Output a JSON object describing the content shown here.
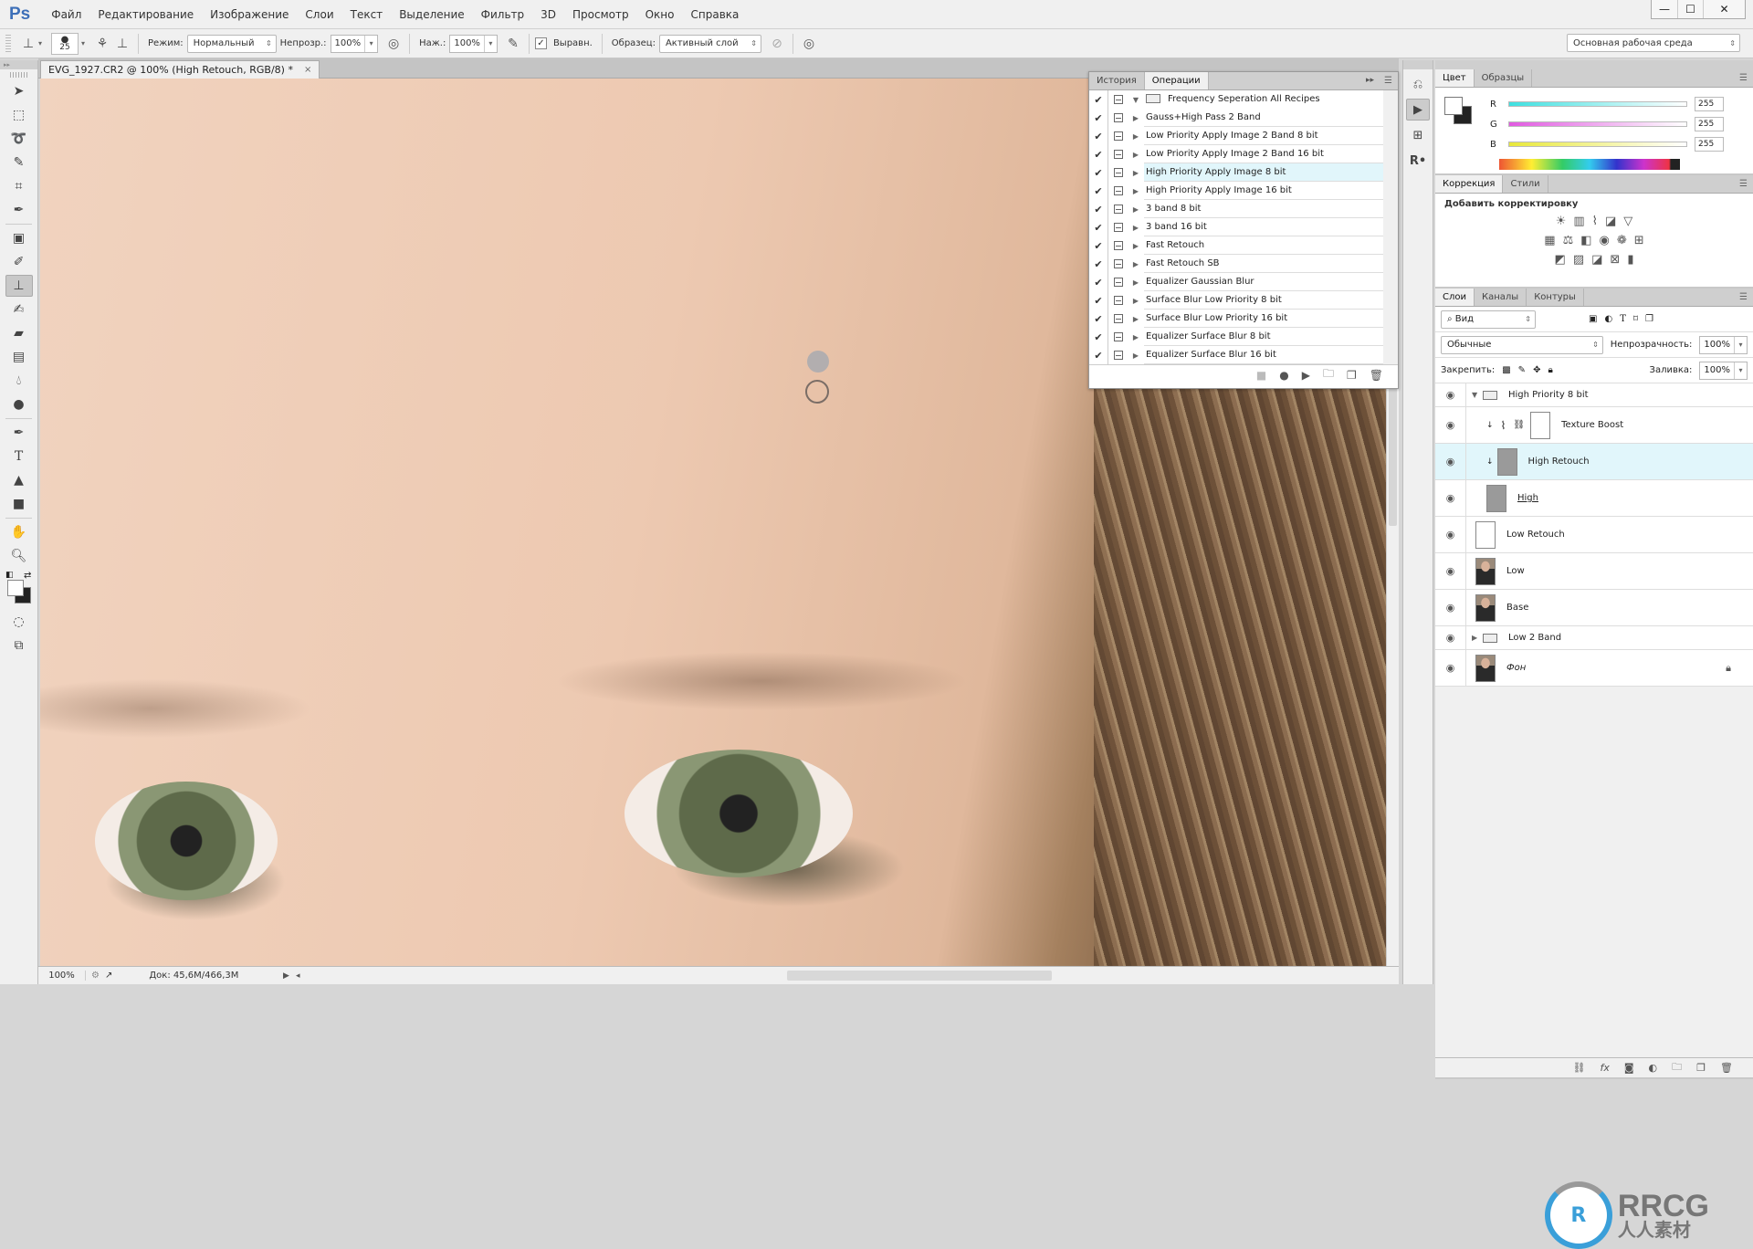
{
  "app": {
    "logo": "Ps"
  },
  "menu": [
    "Файл",
    "Редактирование",
    "Изображение",
    "Слои",
    "Текст",
    "Выделение",
    "Фильтр",
    "3D",
    "Просмотр",
    "Окно",
    "Справка"
  ],
  "window_controls": {
    "minimize": "—",
    "maximize": "☐",
    "close": "✕"
  },
  "options": {
    "brush_size": "25",
    "mode_label": "Режим:",
    "mode_value": "Нормальный",
    "opacity_label": "Непрозр.:",
    "opacity_value": "100%",
    "flow_label": "Наж.:",
    "flow_value": "100%",
    "aligned_label": "Выравн.",
    "aligned_checked": true,
    "sample_label": "Образец:",
    "sample_value": "Активный слой",
    "workspace": "Основная рабочая среда"
  },
  "document": {
    "tab_title": "EVG_1927.CR2 @ 100% (High Retouch, RGB/8) *",
    "close": "×",
    "zoom": "100%",
    "doc_size": "Док: 45,6M/466,3M"
  },
  "actions_panel": {
    "tabs": [
      "История",
      "Операции"
    ],
    "active_tab": 1,
    "set_name": "Frequency Seperation All Recipes",
    "items": [
      {
        "name": "Gauss+High Pass 2 Band",
        "selected": false
      },
      {
        "name": "Low Priority Apply Image 2 Band 8 bit",
        "selected": false
      },
      {
        "name": "Low Priority Apply Image 2 Band 16 bit",
        "selected": false
      },
      {
        "name": "High Priority Apply Image 8 bit",
        "selected": true
      },
      {
        "name": "High Priority Apply Image 16 bit",
        "selected": false
      },
      {
        "name": "3 band 8 bit",
        "selected": false
      },
      {
        "name": "3 band 16 bit",
        "selected": false
      },
      {
        "name": "Fast Retouch",
        "selected": false
      },
      {
        "name": "Fast Retouch SB",
        "selected": false
      },
      {
        "name": "Equalizer Gaussian Blur",
        "selected": false
      },
      {
        "name": "Surface Blur Low Priority 8 bit",
        "selected": false
      },
      {
        "name": "Surface Blur Low Priority 16 bit",
        "selected": false
      },
      {
        "name": "Equalizer Surface Blur 8 bit",
        "selected": false
      },
      {
        "name": "Equalizer Surface Blur 16 bit",
        "selected": false
      }
    ],
    "footer_icons": [
      "stop-icon",
      "record-icon",
      "play-icon",
      "new-set-icon",
      "new-action-icon",
      "delete-icon"
    ]
  },
  "color_panel": {
    "tabs": [
      "Цвет",
      "Образцы"
    ],
    "channels": [
      {
        "label": "R",
        "value": "255",
        "color": "#3ee0e0"
      },
      {
        "label": "G",
        "value": "255",
        "color": "#e05ae0"
      },
      {
        "label": "B",
        "value": "255",
        "color": "#e8e83a"
      }
    ]
  },
  "adjustments_panel": {
    "tabs": [
      "Коррекция",
      "Стили"
    ],
    "title": "Добавить корректировку"
  },
  "layers_panel": {
    "tabs": [
      "Слои",
      "Каналы",
      "Контуры"
    ],
    "filter": "Вид",
    "blend_mode": "Обычные",
    "opacity_label": "Непрозрачность:",
    "opacity_value": "100%",
    "lock_label": "Закрепить:",
    "fill_label": "Заливка:",
    "fill_value": "100%",
    "layers": [
      {
        "name": "High Priority 8 bit",
        "type": "group-open"
      },
      {
        "name": "Texture Boost",
        "type": "curves-adjustment"
      },
      {
        "name": "High Retouch",
        "type": "gray",
        "selected": true
      },
      {
        "name": "High",
        "type": "gray"
      },
      {
        "name": "Low Retouch",
        "type": "white"
      },
      {
        "name": "Low",
        "type": "photo"
      },
      {
        "name": "Base",
        "type": "photo"
      },
      {
        "name": "Low 2 Band",
        "type": "group-closed"
      },
      {
        "name": "Фон",
        "type": "photo",
        "locked": true
      }
    ]
  },
  "watermark": {
    "line1": "RRCG",
    "line2": "人人素材"
  }
}
